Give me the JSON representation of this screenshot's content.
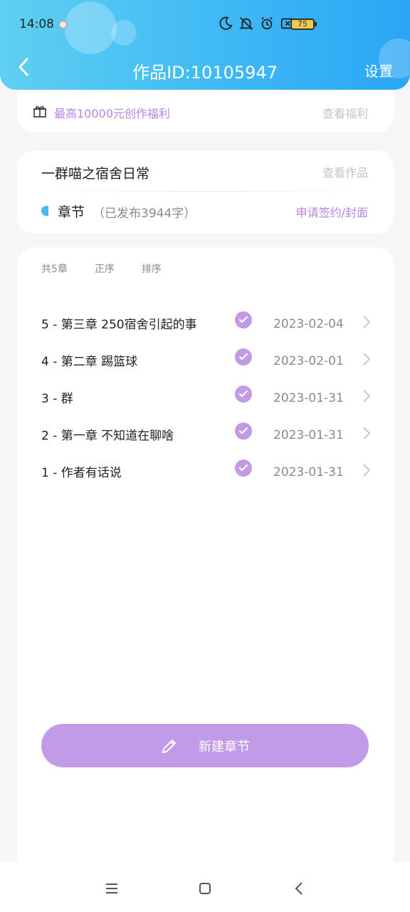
{
  "status": {
    "time": "14:08",
    "battery": "75"
  },
  "header": {
    "title": "作品ID:10105947",
    "settings_label": "设置"
  },
  "benefit": {
    "text": "最高10000元创作福利",
    "link": "查看福利"
  },
  "work": {
    "title": "一群喵之宿舍日常",
    "view_link": "查看作品",
    "chapter_label": "章节",
    "chapter_count": "（已发布3944字）",
    "sign_link": "申请签约/封面"
  },
  "list": {
    "tabs": [
      "共5章",
      "正序",
      "排序"
    ],
    "chapters": [
      {
        "title": "5 - 第三章 250宿舍引起的事",
        "date": "2023-02-04"
      },
      {
        "title": "4 - 第二章 踢篮球",
        "date": "2023-02-01"
      },
      {
        "title": "3 - 群",
        "date": "2023-01-31"
      },
      {
        "title": "2 - 第一章 不知道在聊啥",
        "date": "2023-01-31"
      },
      {
        "title": "1 - 作者有话说",
        "date": "2023-01-31"
      }
    ]
  },
  "new_chapter_label": "新建章节",
  "colors": {
    "accent": "#c19be8",
    "header_start": "#5fd0f2",
    "header_end": "#2aa6f5"
  },
  "icons": [
    "back-icon",
    "gift-icon",
    "check-icon",
    "chevron-right-icon",
    "pencil-icon",
    "menu-icon",
    "home-icon",
    "nav-back-icon"
  ]
}
